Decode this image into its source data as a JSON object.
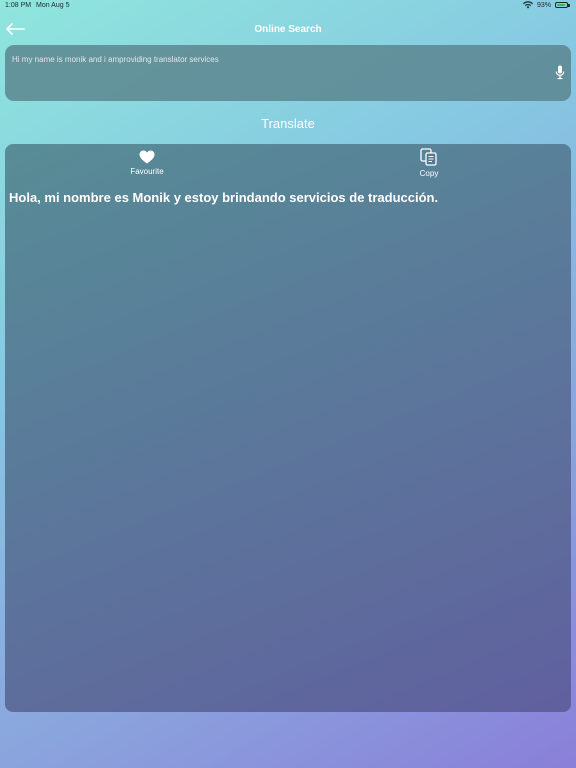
{
  "status_bar": {
    "time": "1:08 PM",
    "date": "Mon Aug 5",
    "battery": "93%",
    "battery_level": 0.93,
    "wifi_icon": "wifi-icon",
    "battery_icon": "battery-icon"
  },
  "nav": {
    "title": "Online Search",
    "back_icon": "arrow-left-icon"
  },
  "search": {
    "value": "Hi my name is monik and i amproviding translator services",
    "mic_icon": "microphone-icon"
  },
  "translate_label": "Translate",
  "result": {
    "favourite_label": "Favourite",
    "favourite_icon": "heart-icon",
    "copy_label": "Copy",
    "copy_icon": "copy-icon",
    "text": "Hola, mi nombre es Monik y estoy brindando servicios de traducción."
  },
  "colors": {
    "background_start": "#8fe6dd",
    "background_end": "#8a7fd9",
    "text": "#ffffff"
  }
}
